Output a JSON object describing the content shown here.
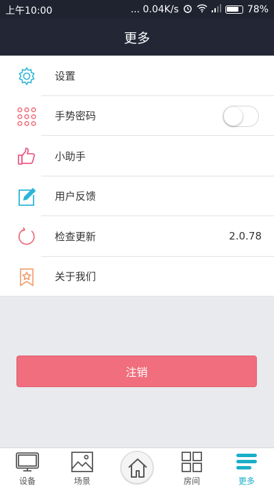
{
  "status_bar": {
    "time": "上午10:00",
    "network_speed": "... 0.04K/s",
    "battery": "78%"
  },
  "header": {
    "title": "更多"
  },
  "menu": [
    {
      "label": "设置",
      "icon": "gear-icon",
      "color": "#2bb5d6"
    },
    {
      "label": "手势密码",
      "icon": "gesture-grid-icon",
      "color": "#ef6f7c",
      "toggle": false
    },
    {
      "label": "小助手",
      "icon": "thumbs-up-icon",
      "color": "#e95a86"
    },
    {
      "label": "用户反馈",
      "icon": "edit-icon",
      "color": "#2bb5d6"
    },
    {
      "label": "检查更新",
      "icon": "refresh-icon",
      "color": "#ef6f7c",
      "value": "2.0.78"
    },
    {
      "label": "关于我们",
      "icon": "bookmark-star-icon",
      "color": "#f0a070"
    }
  ],
  "logout_label": "注销",
  "tabs": [
    {
      "label": "设备",
      "icon": "tv-icon"
    },
    {
      "label": "场景",
      "icon": "picture-icon"
    },
    {
      "label": "",
      "icon": "home-icon"
    },
    {
      "label": "房间",
      "icon": "grid-icon"
    },
    {
      "label": "更多",
      "icon": "menu-icon",
      "active": true
    }
  ],
  "colors": {
    "header_bg": "#232735",
    "accent": "#1aaec9",
    "logout": "#f06e7d"
  }
}
